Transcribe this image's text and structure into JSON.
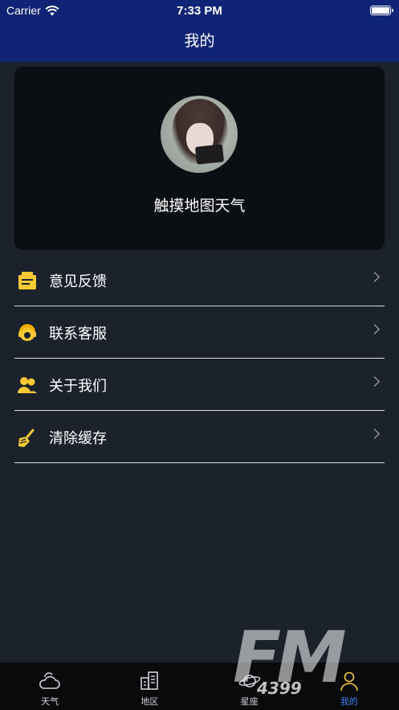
{
  "status_bar": {
    "carrier": "Carrier",
    "time": "7:33 PM"
  },
  "header": {
    "title": "我的"
  },
  "profile": {
    "name": "触摸地图天气"
  },
  "menu": {
    "items": [
      {
        "label": "意见反馈",
        "icon": "feedback-icon"
      },
      {
        "label": "联系客服",
        "icon": "customer-service-icon"
      },
      {
        "label": "关于我们",
        "icon": "about-us-icon"
      },
      {
        "label": "清除缓存",
        "icon": "broom-icon"
      }
    ]
  },
  "tabbar": {
    "items": [
      {
        "label": "天气",
        "icon": "weather-icon",
        "active": false
      },
      {
        "label": "地区",
        "icon": "region-icon",
        "active": false
      },
      {
        "label": "星座",
        "icon": "constellation-icon",
        "active": false
      },
      {
        "label": "我的",
        "icon": "profile-icon",
        "active": true
      }
    ]
  },
  "watermark": {
    "logo": "FM",
    "number": "4399"
  },
  "colors": {
    "header_bg": "#0f2474",
    "page_bg": "#1b222c",
    "card_bg": "#0b0e12",
    "icon_yellow": "#f7c933",
    "tab_active": "#3d7ff3",
    "tabbar_bg": "#090a0c"
  }
}
